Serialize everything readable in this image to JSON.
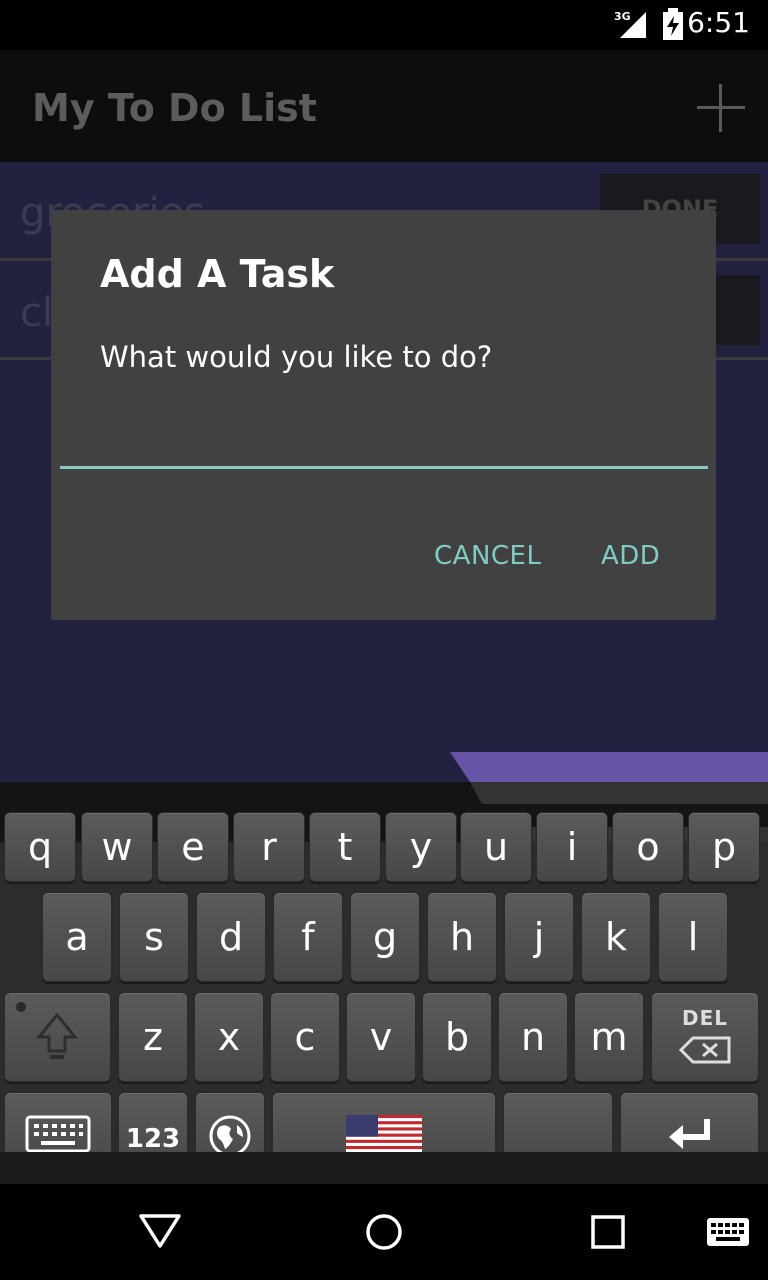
{
  "status_bar": {
    "network": "3G",
    "time": "6:51"
  },
  "action_bar": {
    "title": "My To Do List",
    "add_icon": "plus-icon"
  },
  "list": {
    "items": [
      {
        "label": "groceries",
        "button": "DONE"
      },
      {
        "label": "cl",
        "button": ""
      }
    ]
  },
  "dialog": {
    "title": "Add A Task",
    "message": "What would you like to do?",
    "input_value": "",
    "cancel_label": "CANCEL",
    "add_label": "ADD"
  },
  "keyboard": {
    "row1": [
      "q",
      "w",
      "e",
      "r",
      "t",
      "y",
      "u",
      "i",
      "o",
      "p"
    ],
    "row2": [
      "a",
      "s",
      "d",
      "f",
      "g",
      "h",
      "j",
      "k",
      "l"
    ],
    "row3": [
      "z",
      "x",
      "c",
      "v",
      "b",
      "n",
      "m"
    ],
    "del_label": "DEL",
    "numbers_label": "123",
    "space_icon": "us-flag-icon"
  },
  "colors": {
    "accent": "#80cbc4",
    "dialog_bg": "#414141",
    "list_bg": "#222240",
    "keyboard_tab": "#6655a6"
  }
}
